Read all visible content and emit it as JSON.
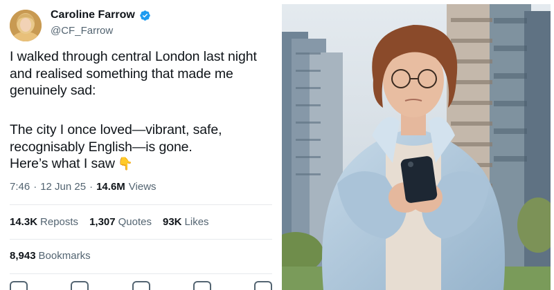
{
  "tweet": {
    "display_name": "Caroline Farrow",
    "handle": "@CF_Farrow",
    "paragraph1": "I walked through central London last night and realised something that made me genuinely sad:",
    "paragraph2_lines": [
      "The city I once loved—vibrant, safe,",
      "recognisably English—is gone.",
      "Here’s what I saw"
    ],
    "emoji": "👇",
    "time": "7:46",
    "date": "12 Jun 25",
    "views_count": "14.6M",
    "views_label": "Views",
    "separator": "·",
    "reposts_count": "14.3K",
    "reposts_label": "Reposts",
    "quotes_count": "1,307",
    "quotes_label": "Quotes",
    "likes_count": "93K",
    "likes_label": "Likes",
    "bookmarks_count": "8,943",
    "bookmarks_label": "Bookmarks"
  },
  "icons": {
    "verified": "verified-badge-icon",
    "avatar": "avatar",
    "emoji": "pointing-down-emoji"
  },
  "colors": {
    "verified_blue": "#1d9bf0",
    "secondary_text": "#536471",
    "primary_text": "#0f1419"
  }
}
